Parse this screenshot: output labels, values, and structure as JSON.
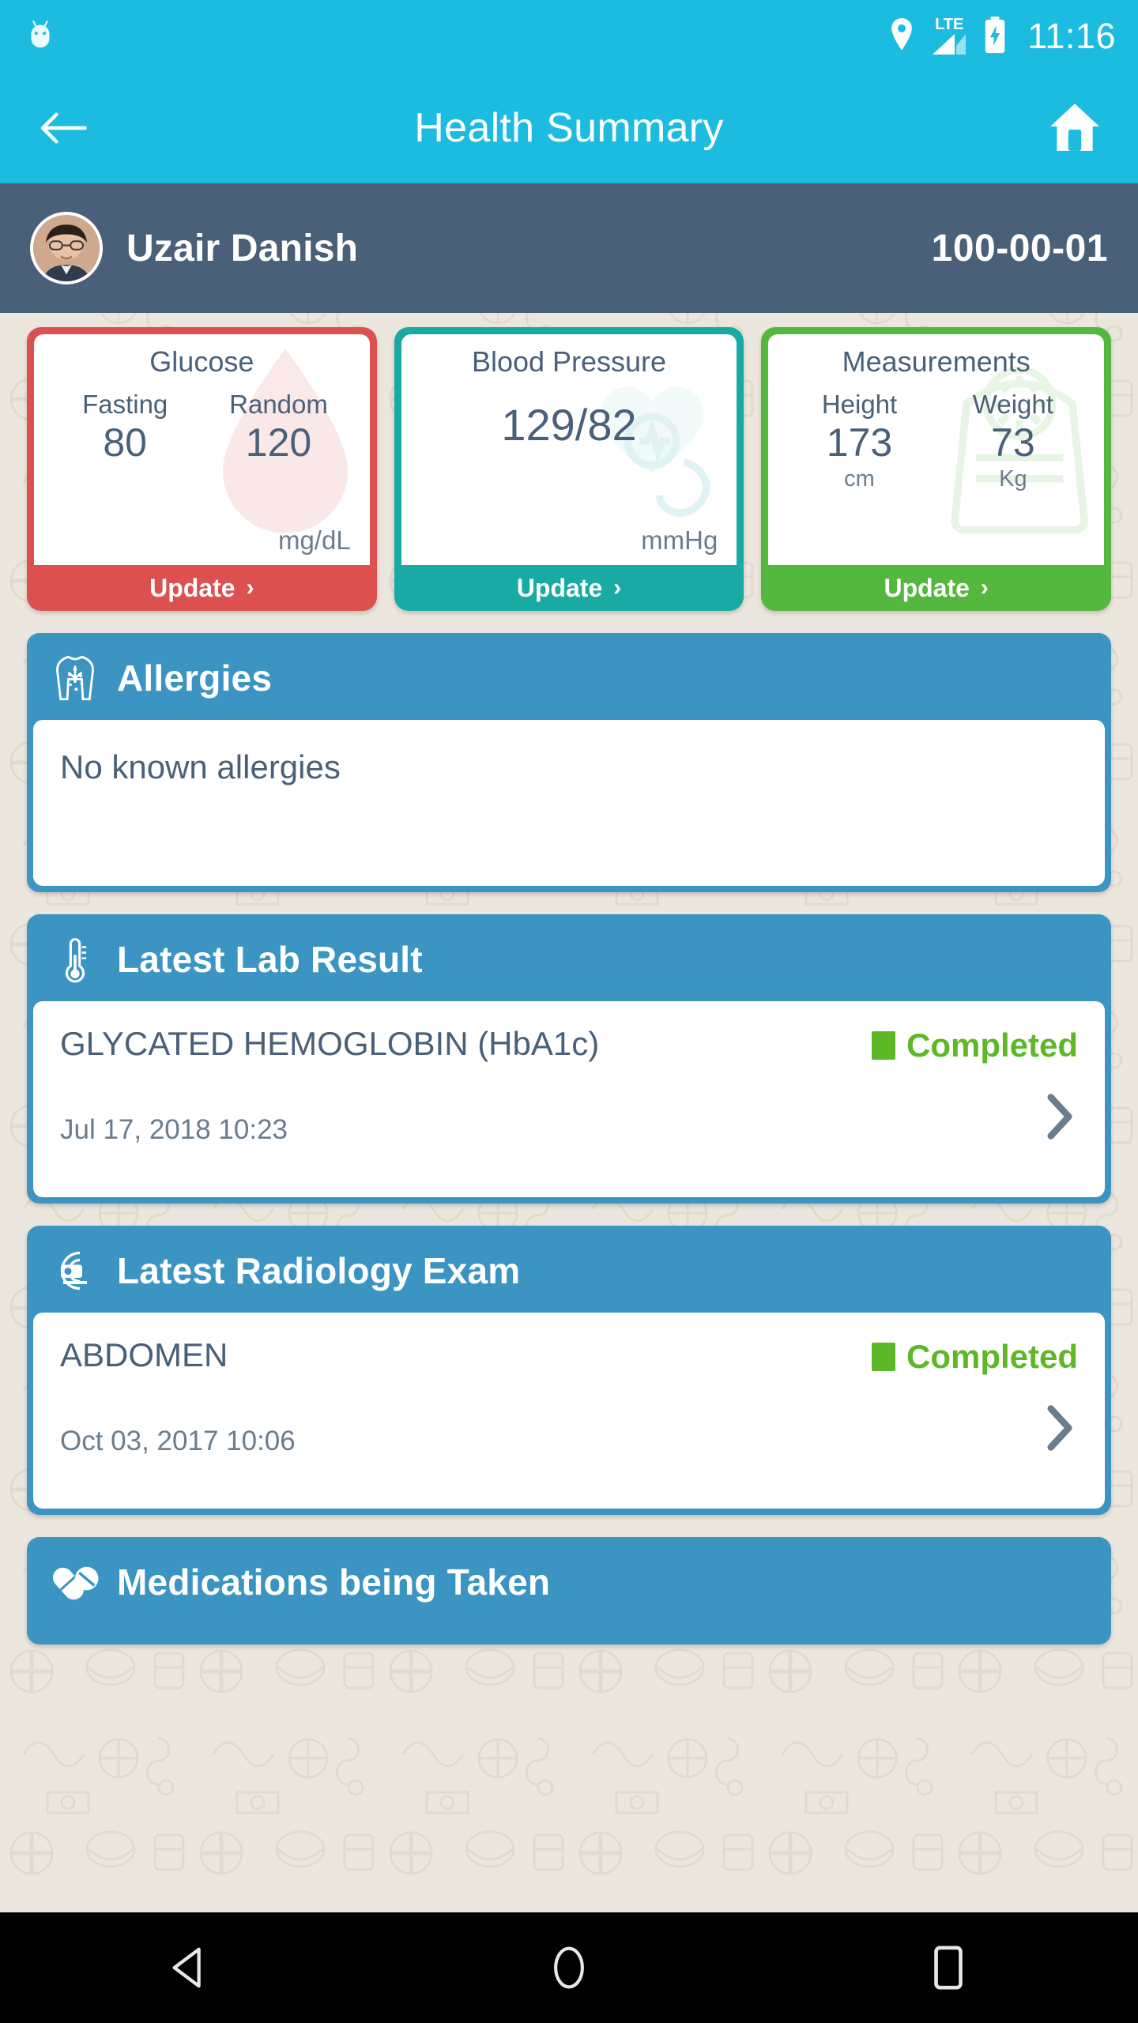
{
  "status_bar": {
    "android_icon": "android-mascot-icon",
    "location_icon": "location-pin-icon",
    "network_label": "LTE",
    "signal_icon": "signal-bars-icon",
    "battery_icon": "battery-charging-icon",
    "time": "11:16"
  },
  "app_bar": {
    "back_icon": "back-arrow-icon",
    "title": "Health Summary",
    "home_icon": "home-icon",
    "background_color": "#1cbce0"
  },
  "patient": {
    "avatar_icon": "patient-avatar",
    "name": "Uzair Danish",
    "mrn": "100-00-01",
    "background_color": "#4a6078"
  },
  "metrics": [
    {
      "key": "glucose",
      "title": "Glucose",
      "accent_color": "#dd5050",
      "watermark_icon": "blood-drop-icon",
      "layout": "pair",
      "pairs": [
        {
          "label": "Fasting",
          "value": "80"
        },
        {
          "label": "Random",
          "value": "120"
        }
      ],
      "unit": "mg/dL",
      "update_label": "Update",
      "chevron": "›"
    },
    {
      "key": "blood_pressure",
      "title": "Blood Pressure",
      "accent_color": "#18aaa3",
      "watermark_icon": "heart-monitor-icon",
      "layout": "single",
      "value": "129/82",
      "unit": "mmHg",
      "update_label": "Update",
      "chevron": "›"
    },
    {
      "key": "measurements",
      "title": "Measurements",
      "accent_color": "#55b83e",
      "watermark_icon": "weighing-scale-icon",
      "layout": "pair",
      "pairs": [
        {
          "label": "Height",
          "value": "173",
          "sub": "cm"
        },
        {
          "label": "Weight",
          "value": "73",
          "sub": "Kg"
        }
      ],
      "update_label": "Update",
      "chevron": "›"
    }
  ],
  "sections": {
    "allergies": {
      "icon": "allergy-torso-icon",
      "title": "Allergies",
      "body_text": "No known allergies"
    },
    "lab_result": {
      "icon": "thermometer-icon",
      "title": "Latest Lab Result",
      "item_name": "GLYCATED HEMOGLOBIN (HbA1c)",
      "status": "Completed",
      "status_color": "#5cb827",
      "date": "Jul 17, 2018 10:23",
      "chevron_icon": "chevron-right-icon"
    },
    "radiology": {
      "icon": "xray-machine-icon",
      "title": "Latest Radiology Exam",
      "item_name": "ABDOMEN",
      "status": "Completed",
      "status_color": "#5cb827",
      "date": "Oct 03, 2017 10:06",
      "chevron_icon": "chevron-right-icon"
    },
    "medications": {
      "icon": "pills-icon",
      "title": "Medications being Taken"
    }
  },
  "nav_bar": {
    "back_icon": "nav-back-triangle-icon",
    "home_icon": "nav-home-circle-icon",
    "recents_icon": "nav-recents-square-icon"
  }
}
